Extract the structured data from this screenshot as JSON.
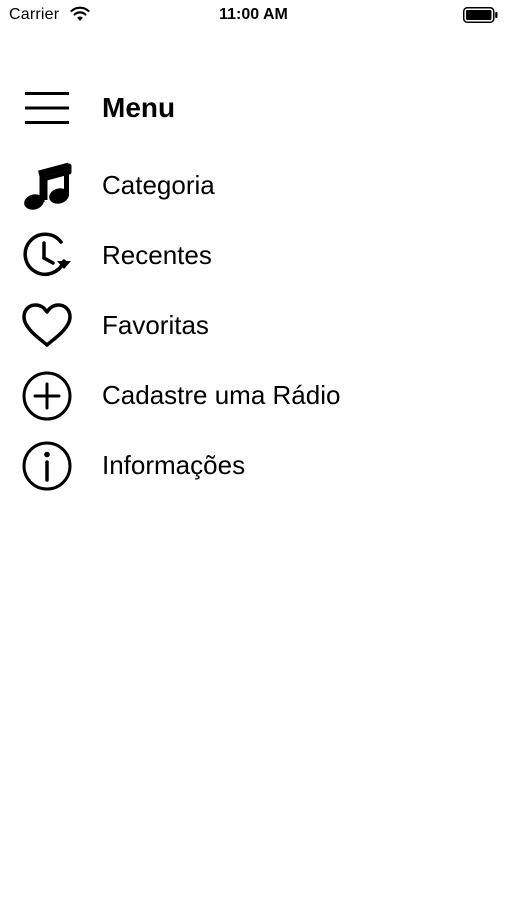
{
  "status_bar": {
    "carrier": "Carrier",
    "time": "11:00 AM",
    "icons": [
      "wifi-icon",
      "battery-icon"
    ]
  },
  "menu": {
    "title": "Menu",
    "toggle_icon": "hamburger-icon",
    "items": [
      {
        "label": "Categoria",
        "icon": "music-note-icon"
      },
      {
        "label": "Recentes",
        "icon": "clock-history-icon"
      },
      {
        "label": "Favoritas",
        "icon": "heart-icon"
      },
      {
        "label": "Cadastre uma Rádio",
        "icon": "plus-circle-icon"
      },
      {
        "label": "Informações",
        "icon": "info-circle-icon"
      }
    ]
  },
  "colors": {
    "background": "#ffffff",
    "foreground": "#000000"
  }
}
